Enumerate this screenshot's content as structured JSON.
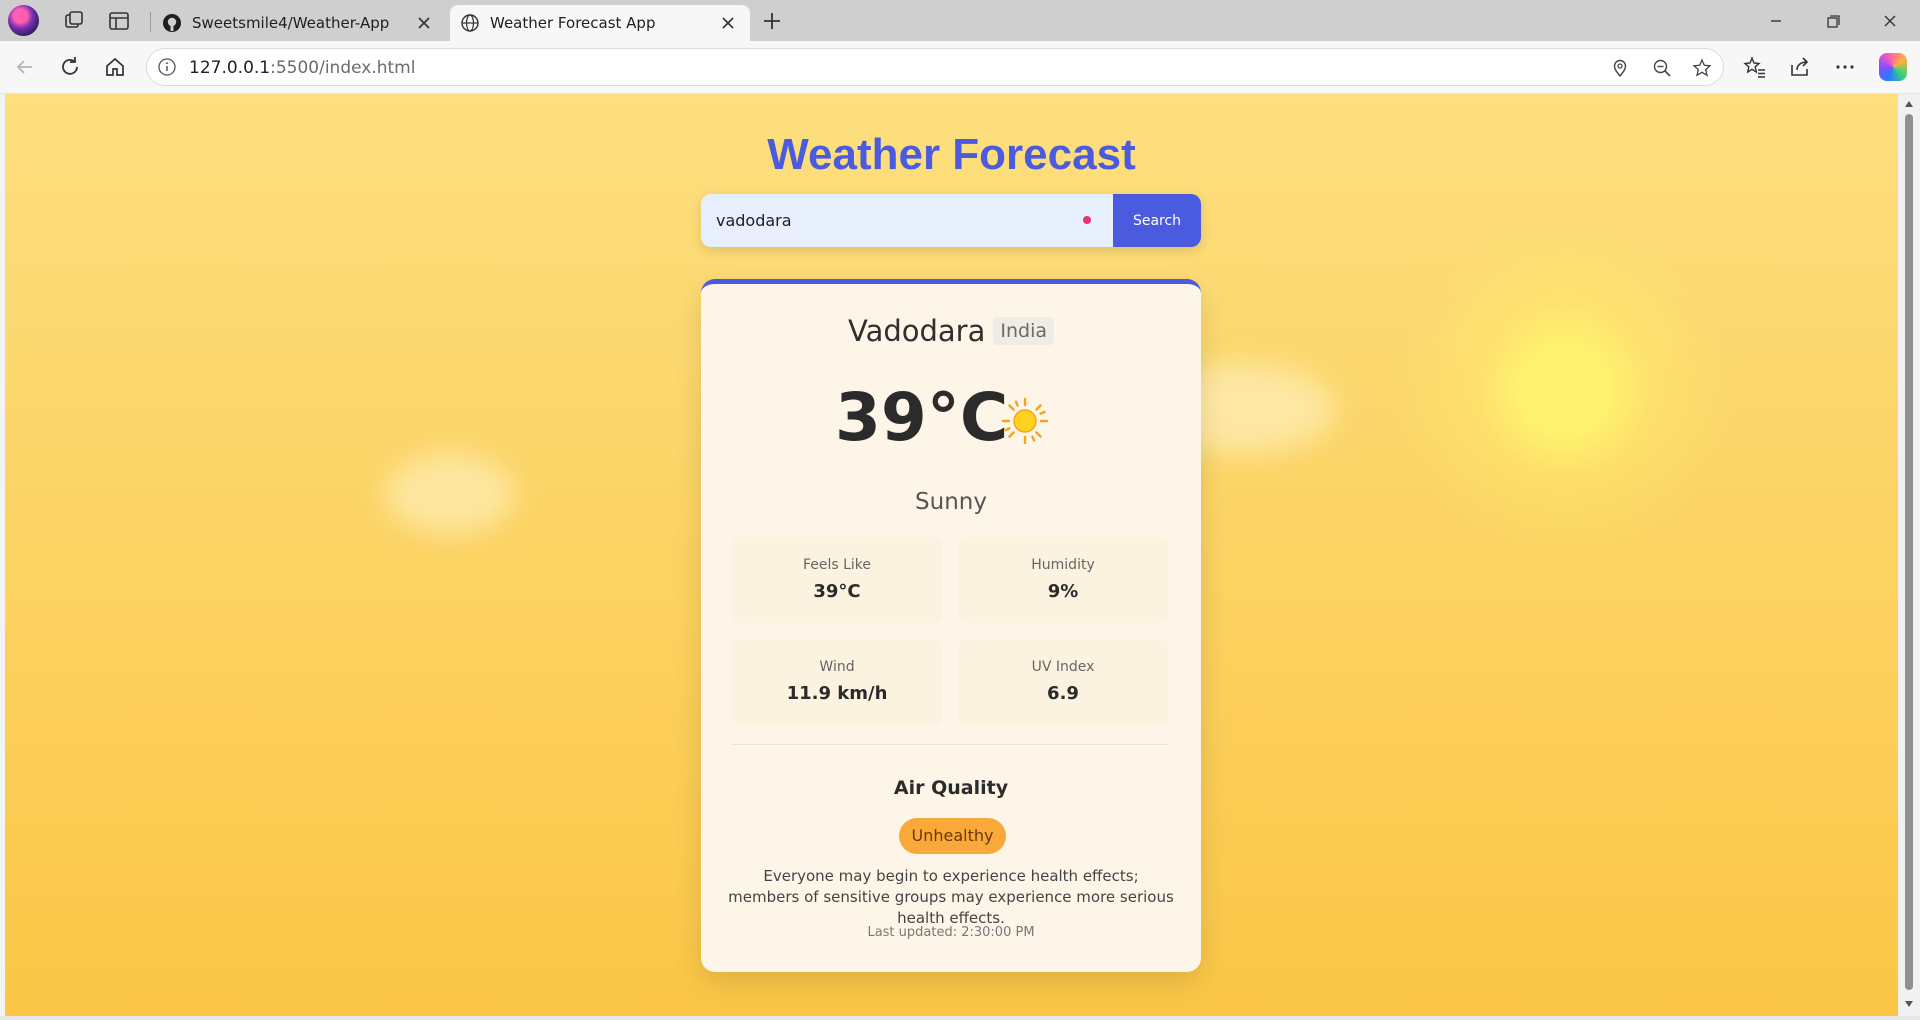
{
  "browser": {
    "tabs": [
      {
        "title": "Sweetsmile4/Weather-App",
        "icon": "github-icon"
      },
      {
        "title": "Weather Forecast App",
        "icon": "globe-icon"
      }
    ],
    "url_host": "127.0.0.1",
    "url_path": ":5500/index.html"
  },
  "app": {
    "title": "Weather Forecast",
    "search": {
      "value": "vadodara",
      "button_label": "Search"
    }
  },
  "weather": {
    "city": "Vadodara",
    "country": "India",
    "temperature": "39°C",
    "condition": "Sunny",
    "icon": "sun-icon",
    "stats": [
      {
        "label": "Feels Like",
        "value": "39°C"
      },
      {
        "label": "Humidity",
        "value": "9%"
      },
      {
        "label": "Wind",
        "value": "11.9 km/h"
      },
      {
        "label": "UV Index",
        "value": "6.9"
      }
    ],
    "air_quality": {
      "title": "Air Quality",
      "status": "Unhealthy",
      "status_color": "#f9a93a",
      "description": "Everyone may begin to experience health effects; members of sensitive groups may experience more serious health effects."
    },
    "last_updated": "Last updated: 2:30:00 PM"
  },
  "colors": {
    "accent": "#4a5be0",
    "page_bg": "#fcd465"
  }
}
